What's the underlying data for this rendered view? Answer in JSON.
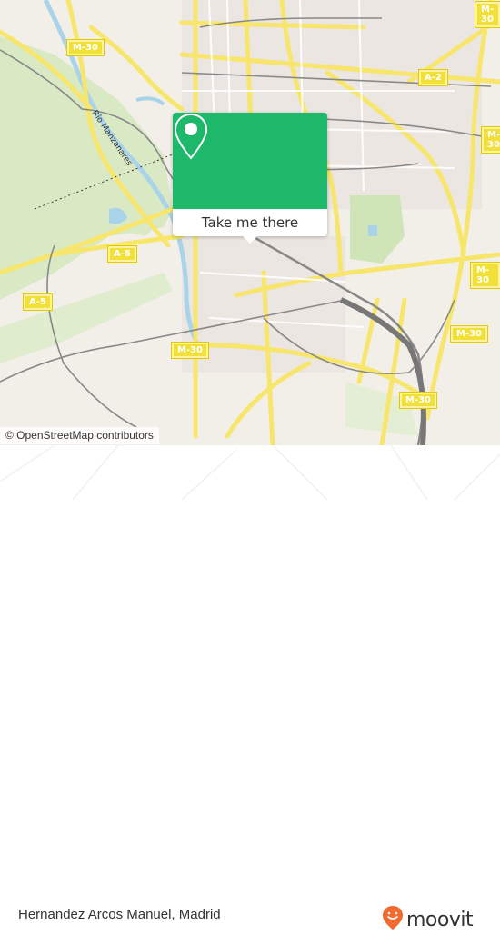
{
  "map": {
    "road_labels": [
      "M-30",
      "A-2",
      "M-30",
      "M-30",
      "M-30",
      "M-30",
      "A-5",
      "A-5",
      "M-30"
    ],
    "river_label": "Río Manzanares",
    "attribution": "© OpenStreetMap contributors",
    "colors": {
      "road": "#f7e66b",
      "park": "#d8e8c0",
      "water": "#a9d3e8",
      "rail": "#888888",
      "land": "#f2efe9"
    }
  },
  "popup": {
    "icon": "map-pin-icon",
    "button_label": "Take me there",
    "color": "#1eb86a"
  },
  "footer": {
    "place_name": "Hernandez Arcos Manuel, Madrid",
    "brand_name": "moovit",
    "brand_icon": "moovit-smile-pin-icon",
    "brand_color": "#f26a30"
  }
}
